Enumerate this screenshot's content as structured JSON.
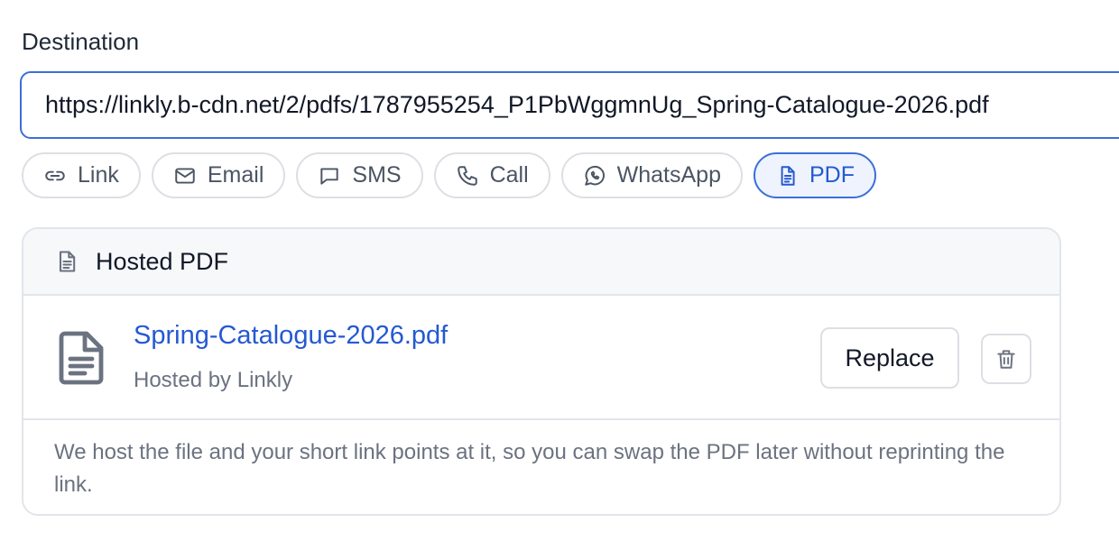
{
  "destination": {
    "label": "Destination",
    "value": "https://linkly.b-cdn.net/2/pdfs/1787955254_P1PbWggmnUg_Spring-Catalogue-2026.pdf"
  },
  "link_types": [
    {
      "label": "Link",
      "icon": "link-icon",
      "active": false
    },
    {
      "label": "Email",
      "icon": "envelope-icon",
      "active": false
    },
    {
      "label": "SMS",
      "icon": "message-icon",
      "active": false
    },
    {
      "label": "Call",
      "icon": "phone-icon",
      "active": false
    },
    {
      "label": "WhatsApp",
      "icon": "whatsapp-icon",
      "active": false
    },
    {
      "label": "PDF",
      "icon": "document-icon",
      "active": true
    }
  ],
  "hosted_pdf": {
    "title": "Hosted PDF",
    "file_name": "Spring-Catalogue-2026.pdf",
    "host_text": "Hosted by Linkly",
    "replace_label": "Replace",
    "note": "We host the file and your short link points at it, so you can swap the PDF later without reprinting the link."
  },
  "colors": {
    "accent": "#2459d1",
    "accent_border": "#3b6fd8",
    "active_bg": "#eef3fd",
    "muted_text": "#6b7280",
    "border": "#dcdfe4"
  }
}
